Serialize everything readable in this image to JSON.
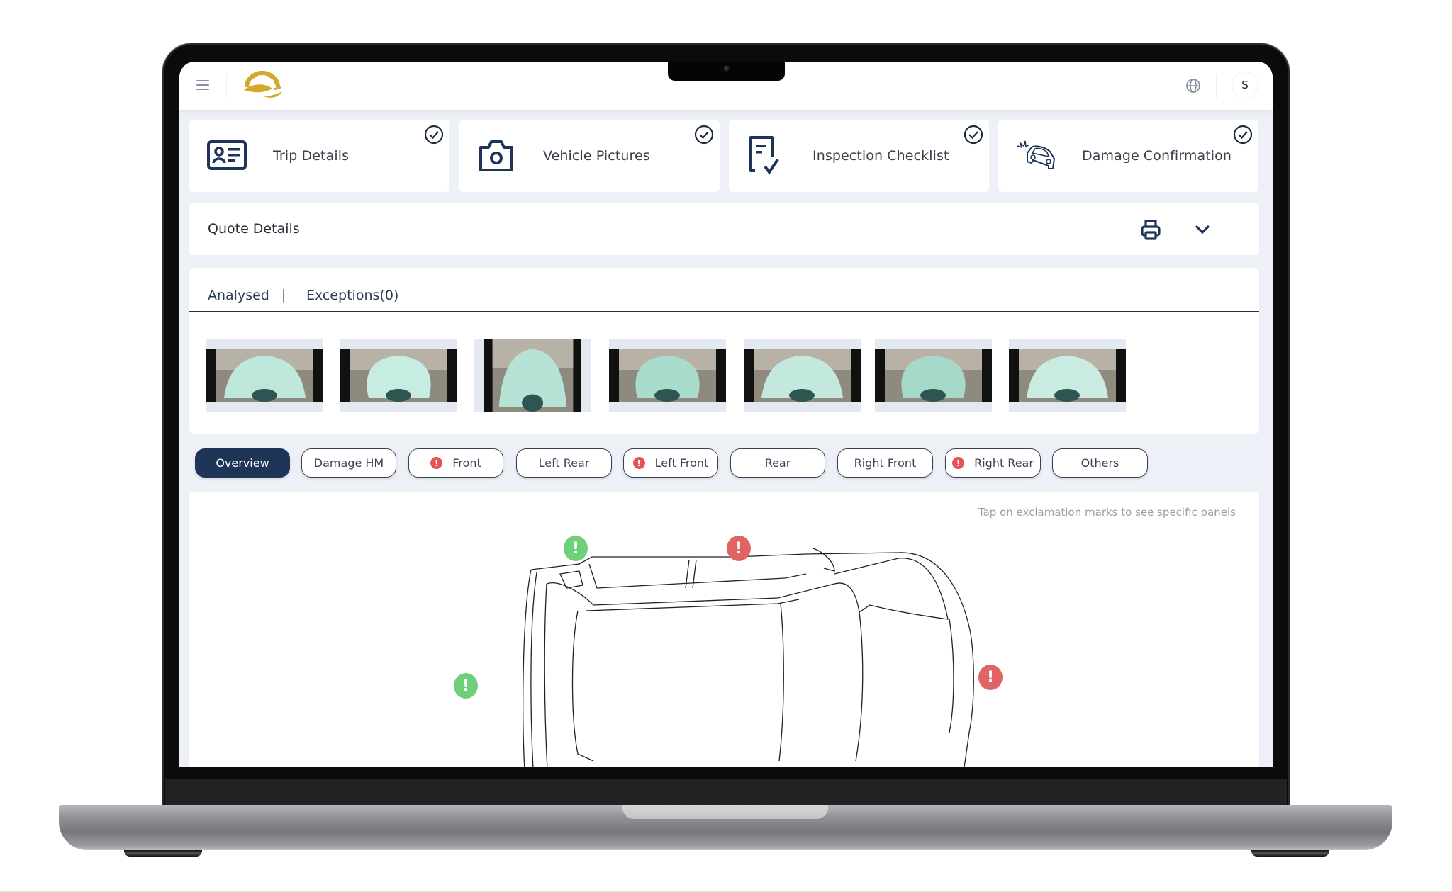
{
  "header": {
    "menu_icon": "hamburger-icon",
    "logo": "gear-leaf-logo",
    "language_icon": "globe-icon",
    "avatar_initial": "S"
  },
  "steps": [
    {
      "label": "Trip Details",
      "icon": "id-card-icon",
      "completed": true
    },
    {
      "label": "Vehicle Pictures",
      "icon": "camera-icon",
      "completed": true
    },
    {
      "label": "Inspection Checklist",
      "icon": "checklist-icon",
      "completed": true
    },
    {
      "label": "Damage Confirmation",
      "icon": "car-crash-icon",
      "completed": true
    }
  ],
  "quote": {
    "title": "Quote Details",
    "print_icon": "printer-icon",
    "expand_icon": "chevron-down-icon"
  },
  "tabs": {
    "analysed": "Analysed",
    "separator": "|",
    "exceptions": "Exceptions(0)",
    "active": "Analysed"
  },
  "thumbnails": [
    {
      "view": "left rear side"
    },
    {
      "view": "left front side"
    },
    {
      "view": "rear"
    },
    {
      "view": "front"
    },
    {
      "view": "rear"
    },
    {
      "view": "front"
    },
    {
      "view": "right rear side"
    }
  ],
  "filters": [
    {
      "label": "Overview",
      "active": true,
      "alert": false
    },
    {
      "label": "Damage HM",
      "active": false,
      "alert": false
    },
    {
      "label": "Front",
      "active": false,
      "alert": true
    },
    {
      "label": "Left Rear",
      "active": false,
      "alert": false
    },
    {
      "label": "Left Front",
      "active": false,
      "alert": true
    },
    {
      "label": "Rear",
      "active": false,
      "alert": false
    },
    {
      "label": "Right Front",
      "active": false,
      "alert": false
    },
    {
      "label": "Right Rear",
      "active": false,
      "alert": true
    },
    {
      "label": "Others",
      "active": false,
      "alert": false
    }
  ],
  "diagram": {
    "hint": "Tap on exclamation marks to see specific panels",
    "alert_glyph": "!",
    "markers": [
      {
        "panel": "left-rear",
        "status": "ok",
        "color": "#6fcf7a"
      },
      {
        "panel": "left-front",
        "status": "damage",
        "color": "#e06464"
      },
      {
        "panel": "rear",
        "status": "ok",
        "color": "#6fcf7a"
      },
      {
        "panel": "front",
        "status": "damage",
        "color": "#e06464"
      }
    ]
  },
  "colors": {
    "brand_navy": "#1e3557",
    "logo_gold": "#d4a82a",
    "alert_red": "#e55454",
    "ok_green": "#6fcf7a",
    "page_bg": "#edf0f6"
  }
}
